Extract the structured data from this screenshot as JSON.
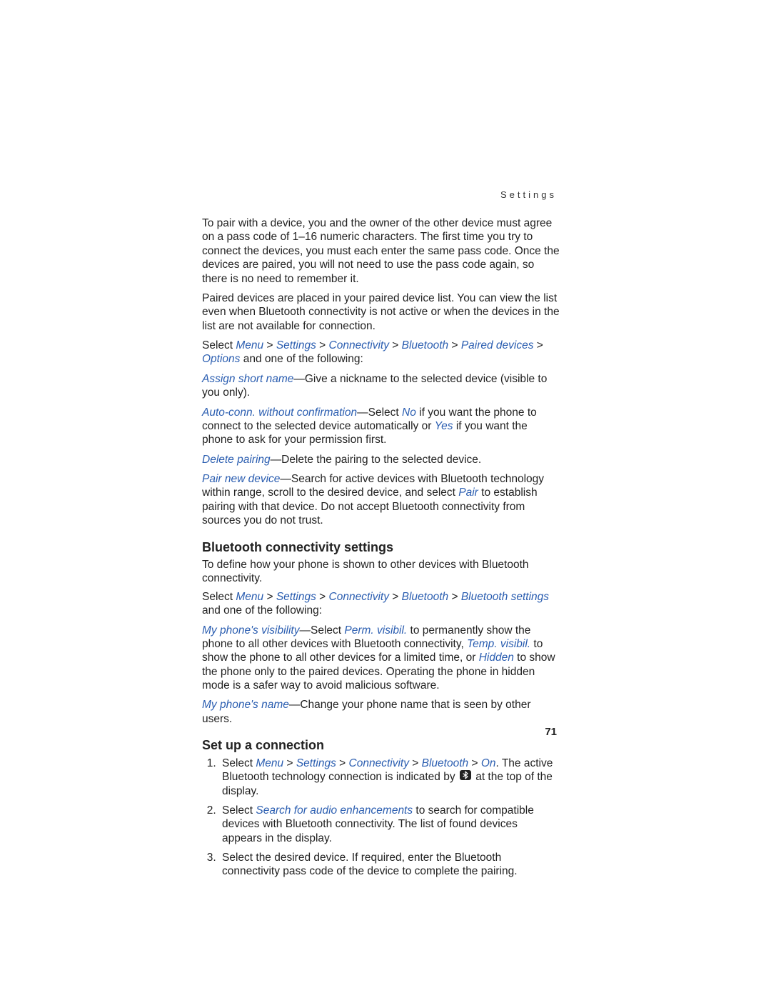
{
  "header": {
    "running": "Settings"
  },
  "paragraphs": {
    "intro1": "To pair with a device, you and the owner of the other device must agree on a pass code of 1–16 numeric characters. The first time you try to connect the devices, you must each enter the same pass code. Once the devices are paired, you will not need to use the pass code again, so there is no need to remember it.",
    "intro2": "Paired devices are placed in your paired device list. You can view the list even when Bluetooth connectivity is not active or when the devices in the list are not available for connection.",
    "select_prefix": "Select ",
    "breadcrumb1_menu": "Menu",
    "gt": " > ",
    "breadcrumb1_settings": "Settings",
    "breadcrumb1_connectivity": "Connectivity",
    "breadcrumb1_bluetooth": "Bluetooth",
    "breadcrumb1_paired": "Paired devices",
    "breadcrumb1_options": "Options",
    "select_suffix": " and one of the following:",
    "assign_label": "Assign short name",
    "assign_text": "—Give a nickname to the selected device (visible to you only).",
    "autoconn_label": "Auto-conn. without confirmation",
    "autoconn_text1": "—Select ",
    "autoconn_no": "No",
    "autoconn_text2": " if you want the phone to connect to the selected device automatically or ",
    "autoconn_yes": "Yes",
    "autoconn_text3": " if you want the phone to ask for your permission first.",
    "delete_label": "Delete pairing",
    "delete_text": "—Delete the pairing to the selected device.",
    "pairnew_label": "Pair new device",
    "pairnew_text1": "—Search for active devices with Bluetooth technology within range, scroll to the desired device, and select ",
    "pairnew_pair": "Pair",
    "pairnew_text2": " to establish pairing with that device. Do not accept Bluetooth connectivity from sources you do not trust."
  },
  "section1": {
    "heading": "Bluetooth connectivity settings",
    "p1": "To define how your phone is shown to other devices with Bluetooth connectivity.",
    "p2_prefix": "Select ",
    "bc_menu": "Menu",
    "bc_settings": "Settings",
    "bc_connectivity": "Connectivity",
    "bc_bluetooth": "Bluetooth",
    "bc_btsettings": "Bluetooth settings",
    "p2_suffix": " and one of the following:",
    "vis_label": "My phone's visibility",
    "vis_text1": "—Select ",
    "vis_perm": "Perm. visibil.",
    "vis_text2": " to permanently show the phone to all other devices with Bluetooth connectivity, ",
    "vis_temp": "Temp. visibil.",
    "vis_text3": " to show the phone to all other devices for a limited time, or ",
    "vis_hidden": "Hidden",
    "vis_text4": " to show the phone only to the paired devices. Operating the phone in hidden mode is a safer way to avoid malicious software.",
    "name_label": "My phone's name",
    "name_text": "—Change your phone name that is seen by other users."
  },
  "section2": {
    "heading": "Set up a connection",
    "li1_prefix": "Select ",
    "li1_menu": "Menu",
    "li1_settings": "Settings",
    "li1_connectivity": "Connectivity",
    "li1_bluetooth": "Bluetooth",
    "li1_on": "On",
    "li1_mid": ". The active Bluetooth technology connection is indicated by ",
    "li1_suffix": " at the top of the display.",
    "li2_prefix": "Select ",
    "li2_search": "Search for audio enhancements",
    "li2_suffix": " to search for compatible devices with Bluetooth connectivity. The list of found devices appears in the display.",
    "li3": "Select the desired device. If required, enter the Bluetooth connectivity pass code of the device to complete the pairing."
  },
  "page_number": "71"
}
